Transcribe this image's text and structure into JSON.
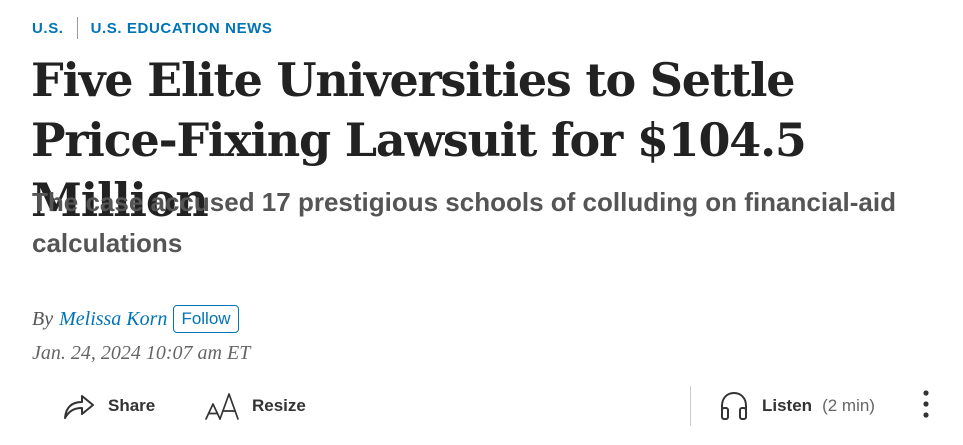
{
  "breadcrumb": {
    "section": "U.S.",
    "subsection": "U.S. EDUCATION NEWS"
  },
  "article": {
    "headline": "Five Elite Universities to Settle Price-Fixing Lawsuit for $104.5 Million",
    "dek": "The case accused 17 prestigious schools of colluding on financial-aid calculations",
    "byline_prefix": "By",
    "author": "Melissa Korn",
    "follow_label": "Follow",
    "timestamp": "Jan. 24, 2024 10:07 am ET"
  },
  "toolbar": {
    "share_label": "Share",
    "share_icon": "share-arrow-icon",
    "resize_label": "Resize",
    "resize_icon": "resize-text-icon",
    "listen_label": "Listen",
    "listen_icon": "headphones-icon",
    "listen_duration": "(2 min)",
    "more_icon": "more-vertical-icon"
  },
  "colors": {
    "accent": "#0274b6",
    "headline": "#222222",
    "dek": "#555555",
    "timestamp": "#666666"
  }
}
